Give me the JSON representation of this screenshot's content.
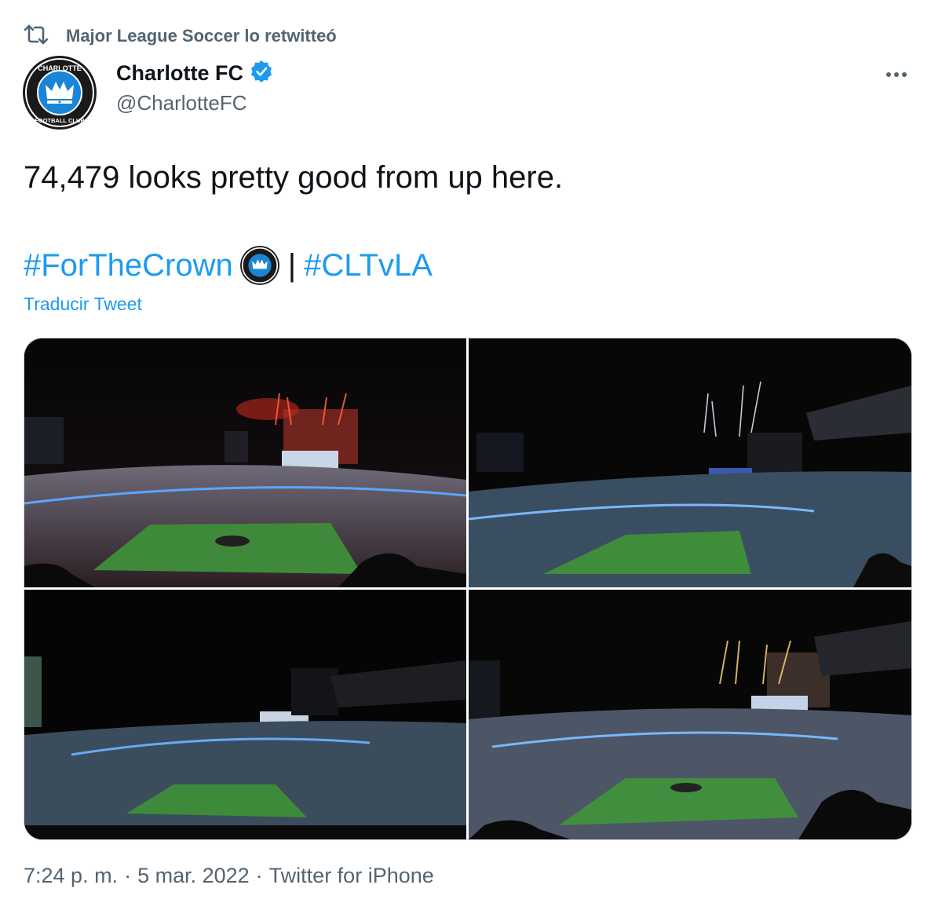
{
  "retweet": {
    "icon": "retweet-icon",
    "text": "Major League Soccer lo retwitteó"
  },
  "author": {
    "name": "Charlotte FC",
    "handle": "@CharlotteFC",
    "verified_icon": "verified-badge-icon",
    "avatar_icon": "charlotte-fc-crest",
    "avatar_text_top": "CHARLOTTE",
    "avatar_text_bottom": "FOOTBALL CLUB"
  },
  "more_icon": "more-horizontal-icon",
  "tweet": {
    "text": "74,479 looks pretty good from up here.",
    "hashtag_1": "#ForTheCrown",
    "emoji": "charlotte-fc-crest-emoji",
    "separator": "|",
    "hashtag_2": "#CLTvLA",
    "translate_label": "Traducir Tweet"
  },
  "media": {
    "photos": [
      {
        "description_icon": "stadium-photo-red-fireworks"
      },
      {
        "description_icon": "stadium-photo-white-fireworks"
      },
      {
        "description_icon": "stadium-photo-night"
      },
      {
        "description_icon": "stadium-photo-gold-fireworks"
      }
    ]
  },
  "meta": {
    "time": "7:24 p. m.",
    "dot1": "·",
    "date": "5 mar. 2022",
    "dot2": "·",
    "source": "Twitter for iPhone"
  },
  "colors": {
    "accent": "#1d9bf0",
    "secondary_text": "#536471",
    "verified": "#1d9bf0"
  }
}
